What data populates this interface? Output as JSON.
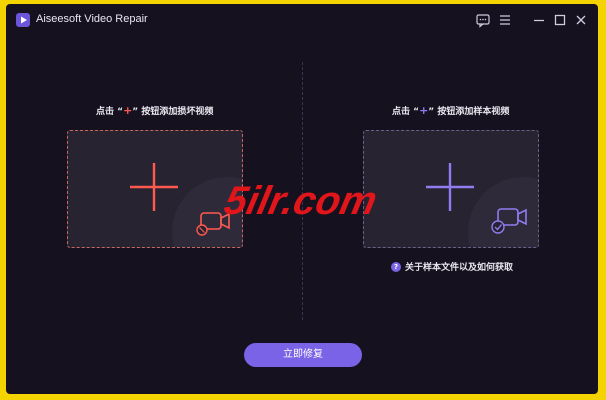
{
  "app": {
    "title": "Aiseesoft Video Repair"
  },
  "left_panel": {
    "hint_prefix": "点击 “",
    "hint_plus": "+",
    "hint_suffix": "” 按钮添加损坏视频",
    "accent_color": "#ff5a4f"
  },
  "right_panel": {
    "hint_prefix": "点击 “",
    "hint_plus": "+",
    "hint_suffix": "” 按钮添加样本视频",
    "accent_color": "#8f7cf0",
    "help_link": "关于样本文件以及如何获取",
    "help_badge": "?"
  },
  "actions": {
    "repair_label": "立即修复"
  },
  "watermark": {
    "text": "5ilr.com"
  },
  "icons": {
    "titlebar": [
      "feedback-icon",
      "menu-icon",
      "minimize-icon",
      "maximize-icon",
      "close-icon"
    ],
    "cards": [
      "plus-icon",
      "broken-camera-icon",
      "camera-check-icon"
    ]
  }
}
